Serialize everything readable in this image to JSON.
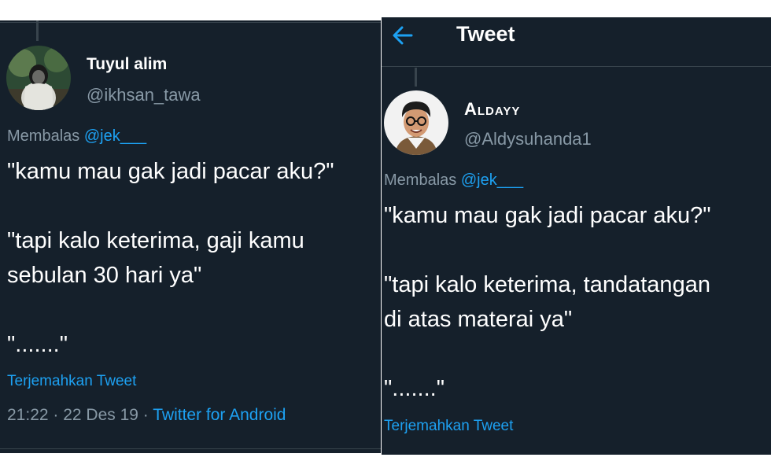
{
  "left_tweet": {
    "display_name": "Tuyul alim",
    "handle": "@ikhsan_tawa",
    "reply_prefix": "Membalas",
    "reply_mention": "@jek___",
    "text": "\"kamu mau gak jadi pacar aku?\"\n\n\"tapi kalo keterima, gaji kamu\nsebulan 30 hari ya\"\n\n\".......\"",
    "translate_label": "Terjemahkan Tweet",
    "timestamp": "21:22 · 22 Des 19 · ",
    "source": "Twitter for Android"
  },
  "right_tweet": {
    "header_title": "Tweet",
    "display_name": "Aldayy",
    "handle": "@Aldysuhanda1",
    "reply_prefix": "Membalas",
    "reply_mention": "@jek___",
    "text": "\"kamu mau gak jadi pacar aku?\"\n\n\"tapi kalo keterima, tandatangan\ndi atas materai ya\"\n\n\".......\"",
    "translate_label": "Terjemahkan Tweet"
  },
  "colors": {
    "background": "#15202b",
    "text": "#ffffff",
    "muted": "#8899a6",
    "accent": "#1da1f2"
  },
  "icons": {
    "back": "arrow-left-icon"
  }
}
